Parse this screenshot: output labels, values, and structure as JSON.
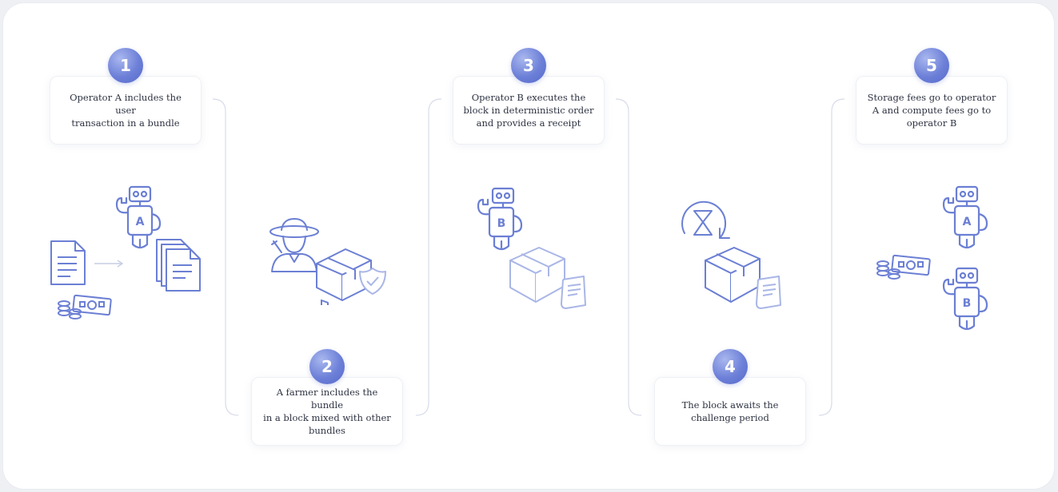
{
  "steps": [
    {
      "number": "1",
      "text": "Operator A includes the user\ntransaction in a bundle"
    },
    {
      "number": "2",
      "text": "A farmer includes the bundle\nin a block mixed with other\nbundles"
    },
    {
      "number": "3",
      "text": "Operator B executes the\nblock in deterministic order\nand provides a receipt"
    },
    {
      "number": "4",
      "text": "The block awaits the\nchallenge period"
    },
    {
      "number": "5",
      "text": "Storage fees go to operator\nA and compute fees go to\noperator B"
    }
  ],
  "robot_labels": {
    "a": "A",
    "b": "B"
  },
  "colors": {
    "icon": "#6b7fd4",
    "icon_light": "#a9b6e6",
    "badge": "#6d80d8",
    "connector": "#d3d8e6"
  },
  "icons": [
    "document-icon",
    "arrow-right-icon",
    "documents-stack-icon",
    "coins-icon",
    "banknote-icon",
    "robot-icon",
    "farmer-icon",
    "box-icon",
    "shield-check-icon",
    "receipt-scroll-icon",
    "hourglass-refresh-icon"
  ]
}
